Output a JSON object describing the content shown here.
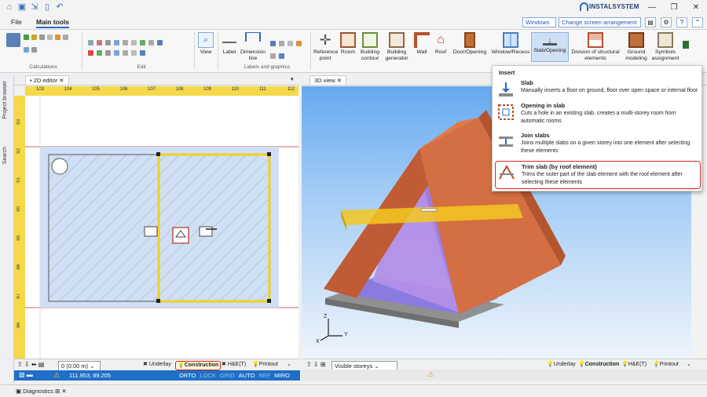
{
  "app": {
    "brand": "INSTALSYSTEM"
  },
  "menu": {
    "file": "File",
    "main_tools": "Main tools",
    "windows_combo": "Windows",
    "screen_combo": "Change screen arrangement"
  },
  "ribbon": {
    "groups": {
      "calculations": "Calculations",
      "edit": "Edit",
      "labels": "Labels and graphics"
    },
    "buttons": {
      "view": "View",
      "label": "Label",
      "dimension": "Dimension line",
      "reference_point": "Reference point",
      "room": "Room",
      "building_contour": "Building contour",
      "building_generator": "Building generator",
      "wall": "Wall",
      "roof": "Roof",
      "door_opening": "Door/Opening",
      "window_recess": "Window/Recess",
      "slab_opening": "Slab/Opening",
      "division": "Division of structural elements",
      "ground": "Ground modeling",
      "symbols": "Symbols assignment"
    }
  },
  "side": {
    "project_browser": "Project browser",
    "search": "Search"
  },
  "editor2d": {
    "tab": "• 2D editor",
    "ruler_top": [
      "103",
      "104",
      "105",
      "106",
      "107",
      "108",
      "109",
      "110",
      "111",
      "112"
    ],
    "ruler_left": [
      "93",
      "92",
      "91",
      "90",
      "89",
      "88",
      "87",
      "86"
    ],
    "storey": "0 (0.00 m)",
    "layers": {
      "underlay": "Underlay",
      "construction": "Construction",
      "he": "H&E(T)",
      "printout": "Printout"
    },
    "coords": "111.953; 89.205",
    "status_flags": [
      "ORTO",
      "LOCK",
      "GRID",
      "AUTO",
      "REF",
      "MIRO"
    ]
  },
  "view3d": {
    "tab": "3D view",
    "visible_storeys": "Visible storeys",
    "layers": {
      "underlay": "Underlay",
      "construction": "Construction",
      "he": "H&E(T)",
      "printout": "Printout"
    },
    "axis_x": "X",
    "axis_y": "Y",
    "axis_z": "Z"
  },
  "dropdown": {
    "header": "Insert",
    "items": [
      {
        "title": "Slab",
        "desc": "Manually inserts a floor on ground, floor over open space or internal floor"
      },
      {
        "title": "Opening in slab",
        "desc": "Cuts a hole in an existing slab, creates a multi-storey room from automatic rooms"
      },
      {
        "title": "Join slabs",
        "desc": "Joins multiple slabs on a given storey into one element after selecting these elements"
      },
      {
        "title": "Trim slab (by roof element)",
        "desc": "Trims the outer part of the slab element with the roof element after selecting these elements"
      }
    ]
  },
  "diagnostics": {
    "label": "Diagnostics"
  },
  "colors": {
    "accent": "#2a6cc1",
    "highlight": "#d9241c",
    "status": "#1f6fc8",
    "ruler": "#f5d94a",
    "roof": "#c8663c",
    "slab": "#f3c820"
  }
}
